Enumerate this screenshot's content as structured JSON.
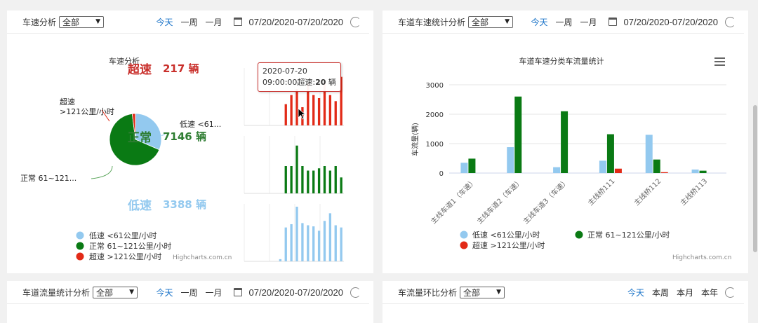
{
  "panels": {
    "top_left": {
      "title": "车速分析",
      "select": "全部",
      "links": [
        "今天",
        "一周",
        "一月"
      ],
      "active": "今天",
      "daterange": "07/20/2020-07/20/2020"
    },
    "top_right": {
      "title": "车道车速统计分析",
      "select": "全部",
      "links": [
        "今天",
        "一周",
        "一月"
      ],
      "active": "今天",
      "daterange": "07/20/2020-07/20/2020"
    },
    "bottom_left": {
      "title": "车道流量统计分析",
      "select": "全部",
      "links": [
        "今天",
        "一周",
        "一月"
      ],
      "active": "今天",
      "daterange": "07/20/2020-07/20/2020"
    },
    "bottom_right": {
      "title": "车流量环比分析",
      "select": "全部",
      "links": [
        "今天",
        "本周",
        "本月",
        "本年"
      ],
      "active": "今天"
    }
  },
  "speed_chart": {
    "title": "车速分析",
    "labels": {
      "over": "超速",
      "over_count": "217 辆",
      "normal": "正常",
      "normal_count": "7146 辆",
      "low": "低速",
      "low_count": "3388 辆"
    },
    "pie_labels": {
      "over": "超速\n>121公里/小时",
      "low": "低速 <61...",
      "normal": "正常 61~121..."
    },
    "tooltip": {
      "line1": "2020-07-20",
      "line2_prefix": "09:00:00超速:",
      "line2_value": "20",
      "line2_suffix": " 辆"
    },
    "legend": [
      "低速 <61公里/小时",
      "正常 61~121公里/小时",
      "超速 >121公里/小时"
    ],
    "credits": "Highcharts.com.cn"
  },
  "chart_data": [
    {
      "type": "pie",
      "categories": [
        "低速 <61公里/小时",
        "正常 61~121公里/小时",
        "超速 >121公里/小时"
      ],
      "values": [
        3388,
        7146,
        217
      ],
      "colors": [
        "#93c9ef",
        "#0a7a14",
        "#e22a17"
      ]
    },
    {
      "type": "bar",
      "title": "车道车速分类车流量统计",
      "ylabel": "车流量(辆)",
      "ylim": [
        0,
        3000
      ],
      "yticks": [
        0,
        1000,
        2000,
        3000
      ],
      "categories": [
        "主线车道1（车速）",
        "主线车道2（车速）",
        "主线车道3（车速）",
        "主线桥111",
        "主线桥112",
        "主线桥113"
      ],
      "series": [
        {
          "name": "低速 <61公里/小时",
          "color": "#93c9ef",
          "values": [
            350,
            880,
            200,
            420,
            1300,
            120
          ]
        },
        {
          "name": "正常 61~121公里/小时",
          "color": "#0a7a14",
          "values": [
            490,
            2600,
            2100,
            1320,
            460,
            80
          ]
        },
        {
          "name": "超速 >121公里/小时",
          "color": "#e22a17",
          "values": [
            0,
            0,
            0,
            150,
            30,
            0
          ]
        }
      ],
      "credits": "Highcharts.com.cn"
    },
    {
      "type": "bar",
      "name": "sparkline-over",
      "color": "#e22a17",
      "values": [
        0,
        0,
        0,
        0,
        0,
        0,
        0,
        14,
        20,
        24,
        12,
        28,
        20,
        18,
        28,
        20,
        16,
        32
      ],
      "ymax": 36
    },
    {
      "type": "bar",
      "name": "sparkline-normal",
      "color": "#0a7a14",
      "values": [
        0,
        0,
        0,
        0,
        0,
        0,
        0,
        24,
        24,
        42,
        24,
        20,
        20,
        22,
        24,
        20,
        24,
        14
      ],
      "ymax": 48
    },
    {
      "type": "bar",
      "name": "sparkline-low",
      "color": "#93c9ef",
      "values": [
        0,
        0,
        0,
        0,
        0,
        0,
        4,
        62,
        68,
        100,
        70,
        66,
        64,
        56,
        74,
        88,
        66,
        62
      ],
      "ymax": 100
    }
  ]
}
